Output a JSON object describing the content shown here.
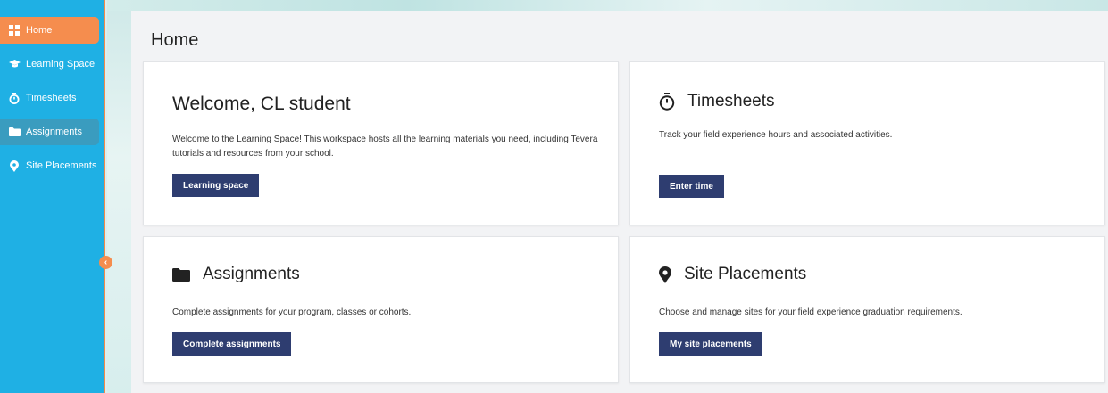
{
  "sidebar": {
    "items": [
      {
        "label": "Home",
        "icon": "grid-icon"
      },
      {
        "label": "Learning Space",
        "icon": "graduation-cap-icon"
      },
      {
        "label": "Timesheets",
        "icon": "stopwatch-icon"
      },
      {
        "label": "Assignments",
        "icon": "folder-icon"
      },
      {
        "label": "Site Placements",
        "icon": "map-pin-icon"
      }
    ],
    "collapse_glyph": "‹"
  },
  "page": {
    "title": "Home"
  },
  "cards": {
    "welcome": {
      "title": "Welcome, CL student",
      "description": "Welcome to the Learning Space! This workspace hosts all the learning materials you need, including Tevera tutorials and resources from your school.",
      "button": "Learning space"
    },
    "timesheets": {
      "title": "Timesheets",
      "description": "Track your field experience hours and associated activities.",
      "button": "Enter time"
    },
    "assignments": {
      "title": "Assignments",
      "description": "Complete assignments for your program, classes or cohorts.",
      "button": "Complete assignments"
    },
    "site_placements": {
      "title": "Site Placements",
      "description": "Choose and manage sites for your field experience graduation requirements.",
      "button": "My site placements"
    }
  },
  "colors": {
    "sidebar_bg": "#1fb0e4",
    "active_item": "#f58d4e",
    "selected_item": "#3a9cbf",
    "button_bg": "#2e3d70"
  }
}
